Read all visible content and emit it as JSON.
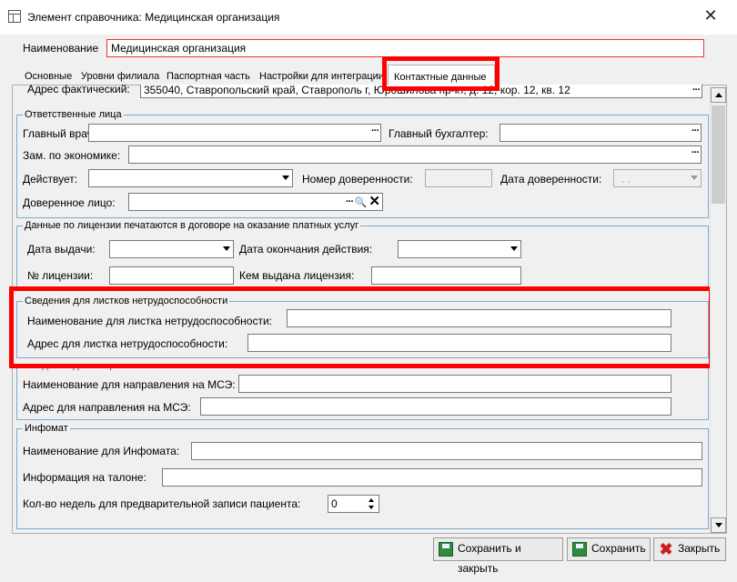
{
  "window": {
    "title": "Элемент справочника: Медицинская организация"
  },
  "name_field": {
    "label": "Наименование",
    "value": "Медицинская организация"
  },
  "tabs": [
    {
      "label": "Основные"
    },
    {
      "label": "Уровни филиала"
    },
    {
      "label": "Паспортная часть"
    },
    {
      "label": "Настройки для интеграции"
    },
    {
      "label": "Контактные данные"
    }
  ],
  "address": {
    "label": "Адрес фактический:",
    "value": "355040, Ставропольский край, Ставрополь г, Юрошилова пр-кт, д. 12, кор. 12, кв. 12"
  },
  "responsible": {
    "title": "Ответственные лица",
    "chief_doctor": "Главный врач:",
    "chief_accountant": "Главный бухгалтер:",
    "deputy_economics": "Зам. по экономике:",
    "acts": "Действует:",
    "poa_number": "Номер доверенности:",
    "poa_date": "Дата доверенности:",
    "poa_date_value": ". .",
    "trusted_person": "Доверенное лицо:"
  },
  "license": {
    "title": "Данные по лицензии печатаются в договоре на оказание платных услуг",
    "issue_date": "Дата выдачи:",
    "expiry_date": "Дата окончания действия:",
    "number": "№ лицензии:",
    "issued_by": "Кем выдана лицензия:"
  },
  "sick_leave": {
    "title": "Сведения для листков нетрудоспособности",
    "name": "Наименование для листка нетрудоспособности:",
    "address": "Адрес для листка нетрудоспособности:"
  },
  "mse": {
    "title": "Сведения для направления на МСЭ",
    "name": "Наименование для направления на МСЭ:",
    "address": "Адрес для направления на МСЭ:"
  },
  "infomat": {
    "title": "Инфомат",
    "name": "Наименование для Инфомата:",
    "ticket_info": "Информация на талоне:",
    "weeks": "Кол-во недель для предварительной записи пациента:",
    "weeks_value": "0"
  },
  "buttons": {
    "save_close": "Сохранить и закрыть",
    "save": "Сохранить",
    "close": "Закрыть"
  },
  "colors": {
    "highlight": "#ff0000",
    "group_border": "#7fa8c9",
    "save_icon": "#2e8b3d",
    "close_icon": "#d01c1c"
  }
}
